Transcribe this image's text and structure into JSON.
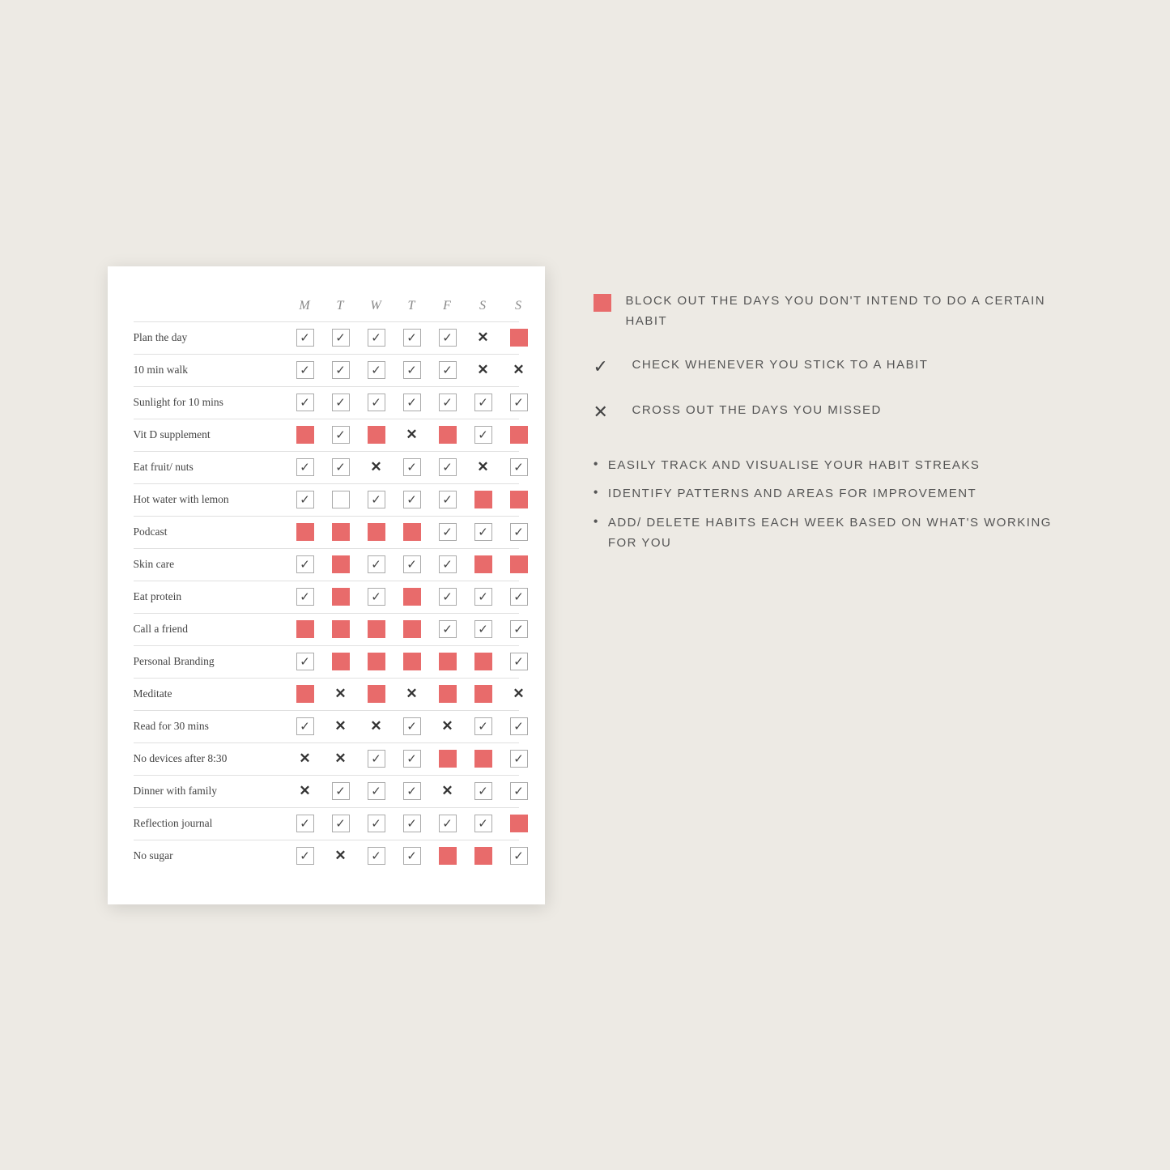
{
  "tracker": {
    "days": [
      "M",
      "T",
      "W",
      "T",
      "F",
      "S",
      "S"
    ],
    "habits": [
      {
        "name": "Plan the day",
        "cells": [
          "check",
          "check",
          "check",
          "check",
          "check",
          "x",
          "red"
        ]
      },
      {
        "name": "10 min walk",
        "cells": [
          "check",
          "check",
          "check",
          "check",
          "check",
          "x",
          "x"
        ]
      },
      {
        "name": "Sunlight for 10 mins",
        "cells": [
          "check",
          "check",
          "check",
          "check",
          "check",
          "check",
          "check"
        ]
      },
      {
        "name": "Vit D supplement",
        "cells": [
          "red",
          "check",
          "red",
          "x",
          "red",
          "check",
          "red"
        ]
      },
      {
        "name": "Eat fruit/ nuts",
        "cells": [
          "check",
          "check",
          "x",
          "check",
          "check",
          "x",
          "check"
        ]
      },
      {
        "name": "Hot water with lemon",
        "cells": [
          "check",
          "empty",
          "check",
          "check",
          "check",
          "red",
          "red"
        ]
      },
      {
        "name": "Podcast",
        "cells": [
          "red",
          "red",
          "red",
          "red",
          "check",
          "check",
          "check"
        ]
      },
      {
        "name": "Skin care",
        "cells": [
          "check",
          "red",
          "check",
          "check",
          "check",
          "red",
          "red"
        ]
      },
      {
        "name": "Eat protein",
        "cells": [
          "check",
          "red",
          "check",
          "red",
          "check",
          "check",
          "check"
        ]
      },
      {
        "name": "Call a friend",
        "cells": [
          "red",
          "red",
          "red",
          "red",
          "check",
          "check",
          "check"
        ]
      },
      {
        "name": "Personal Branding",
        "cells": [
          "check",
          "red",
          "red",
          "red",
          "red",
          "red",
          "check"
        ]
      },
      {
        "name": "Meditate",
        "cells": [
          "red",
          "x",
          "red",
          "x",
          "red",
          "red",
          "x"
        ]
      },
      {
        "name": "Read for 30 mins",
        "cells": [
          "check",
          "x",
          "x",
          "check",
          "x",
          "check",
          "check"
        ]
      },
      {
        "name": "No devices after 8:30",
        "cells": [
          "x",
          "x",
          "check",
          "check",
          "red",
          "red",
          "check"
        ]
      },
      {
        "name": "Dinner with family",
        "cells": [
          "x",
          "check",
          "check",
          "check",
          "x",
          "check",
          "check"
        ]
      },
      {
        "name": "Reflection journal",
        "cells": [
          "check",
          "check",
          "check",
          "check",
          "check",
          "check",
          "red"
        ]
      },
      {
        "name": "No sugar",
        "cells": [
          "check",
          "x",
          "check",
          "check",
          "red",
          "red",
          "check"
        ]
      }
    ]
  },
  "legend": {
    "block_icon": "red",
    "block_text": "BLOCK OUT THE DAYS YOU DON'T INTEND TO DO A CERTAIN HABIT",
    "check_icon": "✓",
    "check_text": "CHECK WHENEVER YOU STICK TO A HABIT",
    "cross_icon": "✕",
    "cross_text": "CROSS OUT THE DAYS YOU MISSED"
  },
  "bullets": [
    "EASILY TRACK AND VISUALISE YOUR HABIT STREAKS",
    "IDENTIFY PATTERNS AND AREAS FOR IMPROVEMENT",
    "ADD/ DELETE HABITS EACH WEEK BASED ON WHAT'S WORKING FOR YOU"
  ]
}
